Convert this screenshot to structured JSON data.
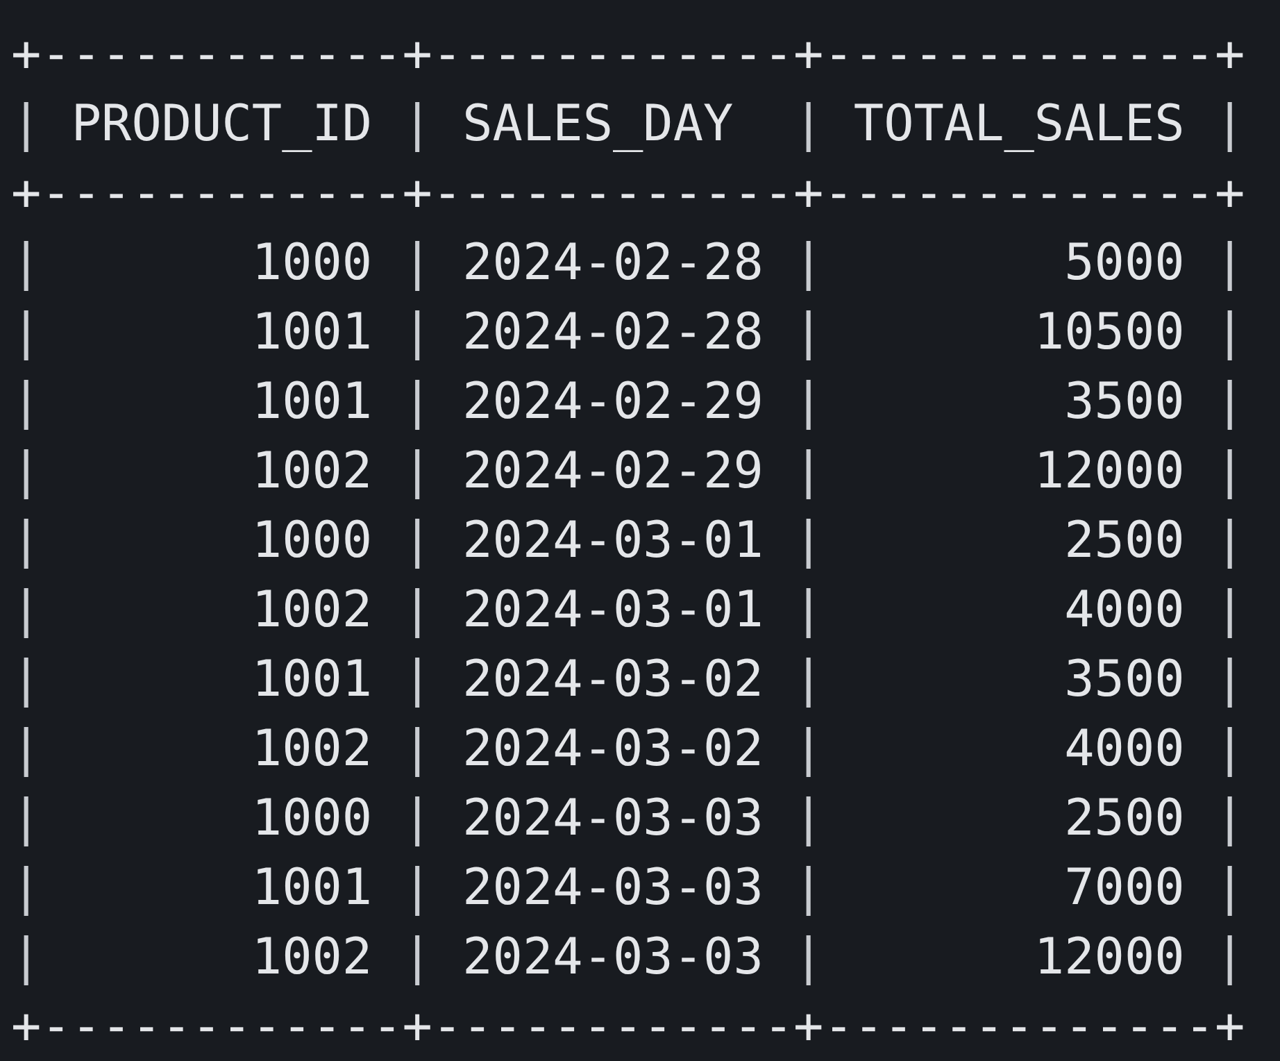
{
  "border_top": "+------------+------------+-------------+",
  "vertical_bar": "|",
  "columns": [
    {
      "label": "PRODUCT_ID",
      "kind": "number"
    },
    {
      "label": "SALES_DAY",
      "kind": "date"
    },
    {
      "label": "TOTAL_SALES",
      "kind": "number"
    }
  ],
  "header_separator": "+------------+------------+-------------+",
  "rows": [
    [
      "1000",
      "2024-02-28",
      "5000"
    ],
    [
      "1001",
      "2024-02-28",
      "10500"
    ],
    [
      "1001",
      "2024-02-29",
      "3500"
    ],
    [
      "1002",
      "2024-02-29",
      "12000"
    ],
    [
      "1000",
      "2024-03-01",
      "2500"
    ],
    [
      "1002",
      "2024-03-01",
      "4000"
    ],
    [
      "1001",
      "2024-03-02",
      "3500"
    ],
    [
      "1002",
      "2024-03-02",
      "4000"
    ],
    [
      "1000",
      "2024-03-03",
      "2500"
    ],
    [
      "1001",
      "2024-03-03",
      "7000"
    ],
    [
      "1002",
      "2024-03-03",
      "12000"
    ]
  ],
  "border_bottom": "+------------+------------+-------------+"
}
